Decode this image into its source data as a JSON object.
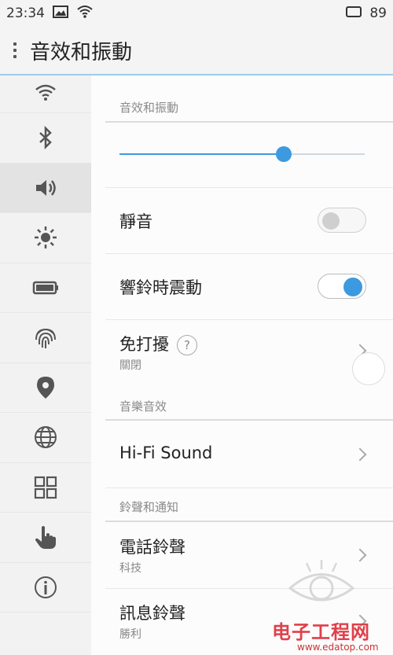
{
  "status_bar": {
    "time": "23:34",
    "battery": "89",
    "icons": [
      "image-icon",
      "wifi-icon",
      "screen-icon"
    ]
  },
  "app_bar": {
    "title": "音效和振動"
  },
  "sidebar": {
    "items": [
      {
        "icon": "wifi-icon"
      },
      {
        "icon": "bluetooth-icon"
      },
      {
        "icon": "volume-icon",
        "active": true
      },
      {
        "icon": "brightness-icon"
      },
      {
        "icon": "battery-icon"
      },
      {
        "icon": "fingerprint-icon"
      },
      {
        "icon": "location-icon"
      },
      {
        "icon": "globe-icon"
      },
      {
        "icon": "apps-grid-icon"
      },
      {
        "icon": "hand-pointer-icon"
      },
      {
        "icon": "info-icon"
      }
    ]
  },
  "sound_vibration": {
    "header": "音效和振動",
    "volume_level": 0.67,
    "mute": {
      "label": "靜音",
      "on": false
    },
    "vibrate_on_ring": {
      "label": "響鈴時震動",
      "on": true
    },
    "dnd": {
      "label": "免打擾",
      "help": "?",
      "value": "關閉"
    }
  },
  "music": {
    "header": "音樂音效",
    "hifi": {
      "label": "Hi-Fi Sound"
    }
  },
  "ringtones": {
    "header": "鈴聲和通知",
    "phone": {
      "label": "電話鈴聲",
      "value": "科技"
    },
    "message": {
      "label": "訊息鈴聲",
      "value": "勝利"
    }
  },
  "watermark": {
    "text": "电子工程网",
    "url": "www.edatop.com"
  },
  "colors": {
    "accent": "#3d9ae0",
    "appbar_line": "#9ecde8"
  }
}
